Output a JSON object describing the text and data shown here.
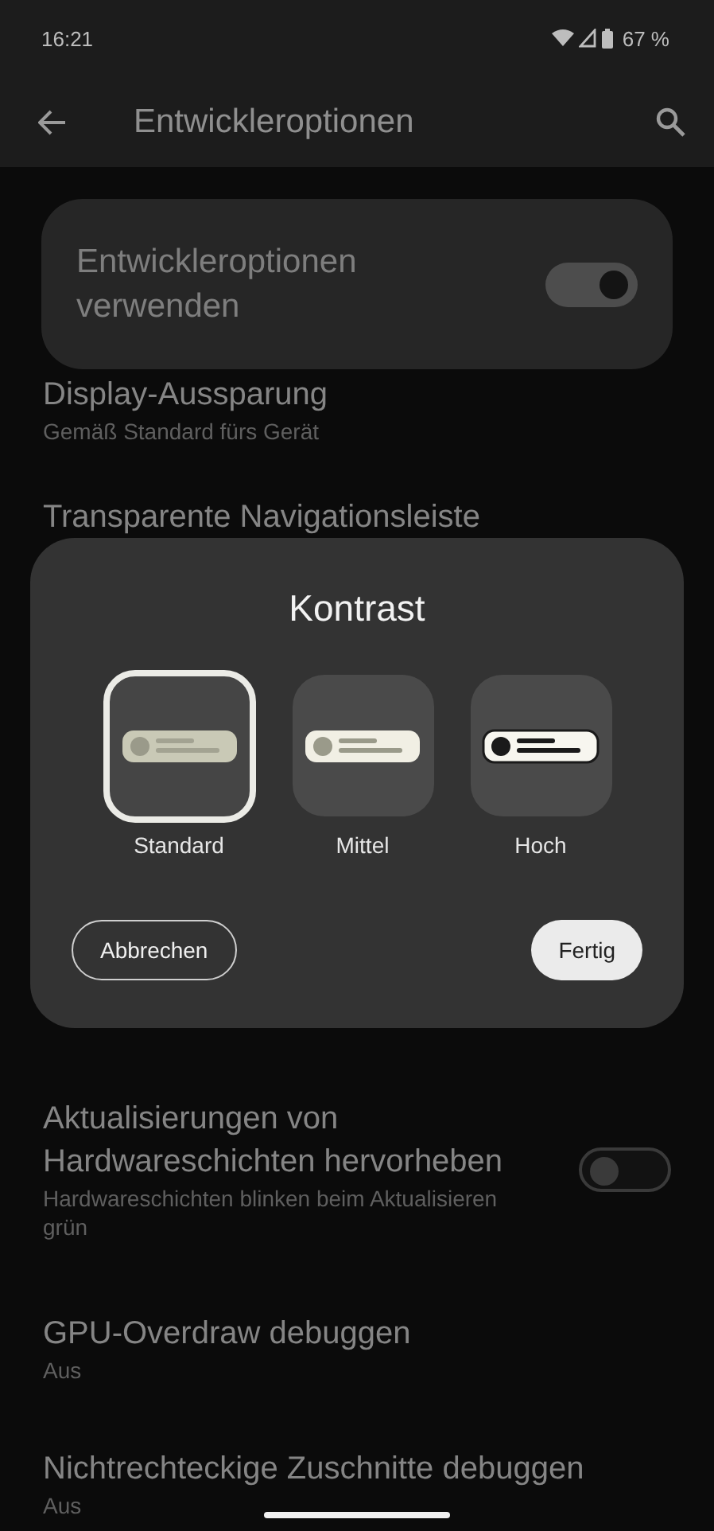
{
  "status_bar": {
    "time": "16:21",
    "battery": "67 %"
  },
  "toolbar": {
    "title": "Entwickleroptionen"
  },
  "settings": [
    {
      "kind": "switch_card",
      "title": "Entwickleroptionen verwenden",
      "on": true
    },
    {
      "kind": "item",
      "title": "Display-Aussparung",
      "subtitle": "Gemäß Standard fürs Gerät"
    },
    {
      "kind": "item",
      "title": "Transparente Navigationsleiste"
    },
    {
      "kind": "switch_item",
      "title": "Aktualisierungen von Hardwareschichten hervorheben",
      "subtitle": "Hardwareschichten blinken beim Aktualisieren grün",
      "on": false
    },
    {
      "kind": "item",
      "title": "GPU-Overdraw debuggen",
      "subtitle": "Aus"
    },
    {
      "kind": "item",
      "title": "Nichtrechteckige Zuschnitte debuggen",
      "subtitle": "Aus"
    }
  ],
  "dialog": {
    "title": "Kontrast",
    "options": [
      {
        "label": "Standard",
        "kind": "standard",
        "selected": true
      },
      {
        "label": "Mittel",
        "kind": "medium",
        "selected": false
      },
      {
        "label": "Hoch",
        "kind": "high",
        "selected": false
      }
    ],
    "cancel": "Abbrechen",
    "confirm": "Fertig"
  }
}
